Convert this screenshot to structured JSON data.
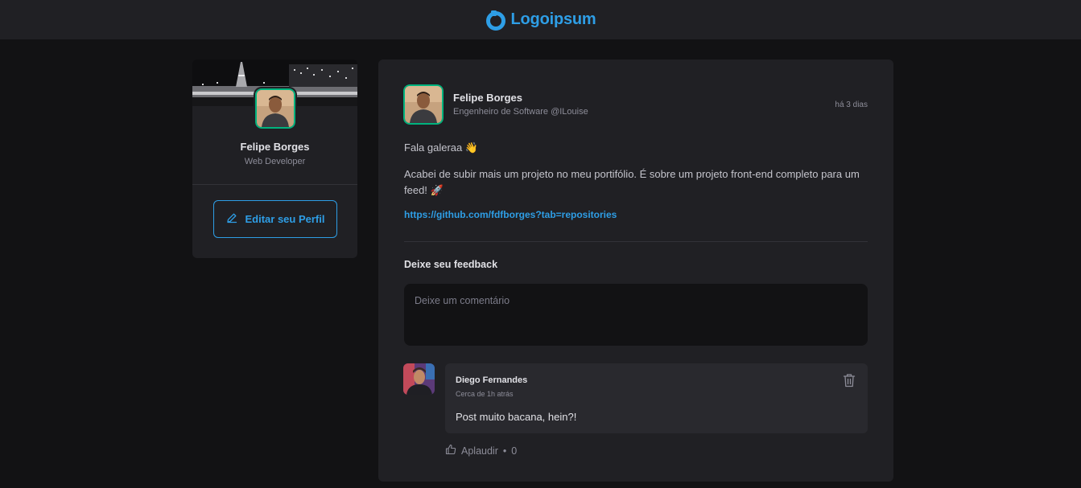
{
  "header": {
    "logo_text": "Logoipsum",
    "logo_icon": "logo-ring-icon",
    "accent": "#2e9ee6"
  },
  "profile": {
    "name": "Felipe Borges",
    "role": "Web Developer",
    "edit_button": "Editar seu Perfil",
    "edit_icon": "pencil-icon",
    "avatar_border": "#00b37e"
  },
  "post": {
    "author": {
      "name": "Felipe Borges",
      "role": "Engenheiro de Software @ILouise"
    },
    "time": "há 3 dias",
    "paragraphs": [
      "Fala galeraa 👋",
      "Acabei de subir mais um projeto no meu portifólio. É sobre um projeto front-end completo para um feed! 🚀"
    ],
    "link": "https://github.com/fdfborges?tab=repositories",
    "feedback_title": "Deixe seu feedback",
    "comment_placeholder": "Deixe um comentário"
  },
  "comments": [
    {
      "author": "Diego Fernandes",
      "time": "Cerca de 1h atrás",
      "text": "Post muito bacana, hein?!",
      "applaud_label": "Aplaudir",
      "applaud_sep": "•",
      "applaud_count": "0",
      "delete_icon": "trash-icon",
      "applaud_icon": "thumbs-up-icon"
    }
  ]
}
